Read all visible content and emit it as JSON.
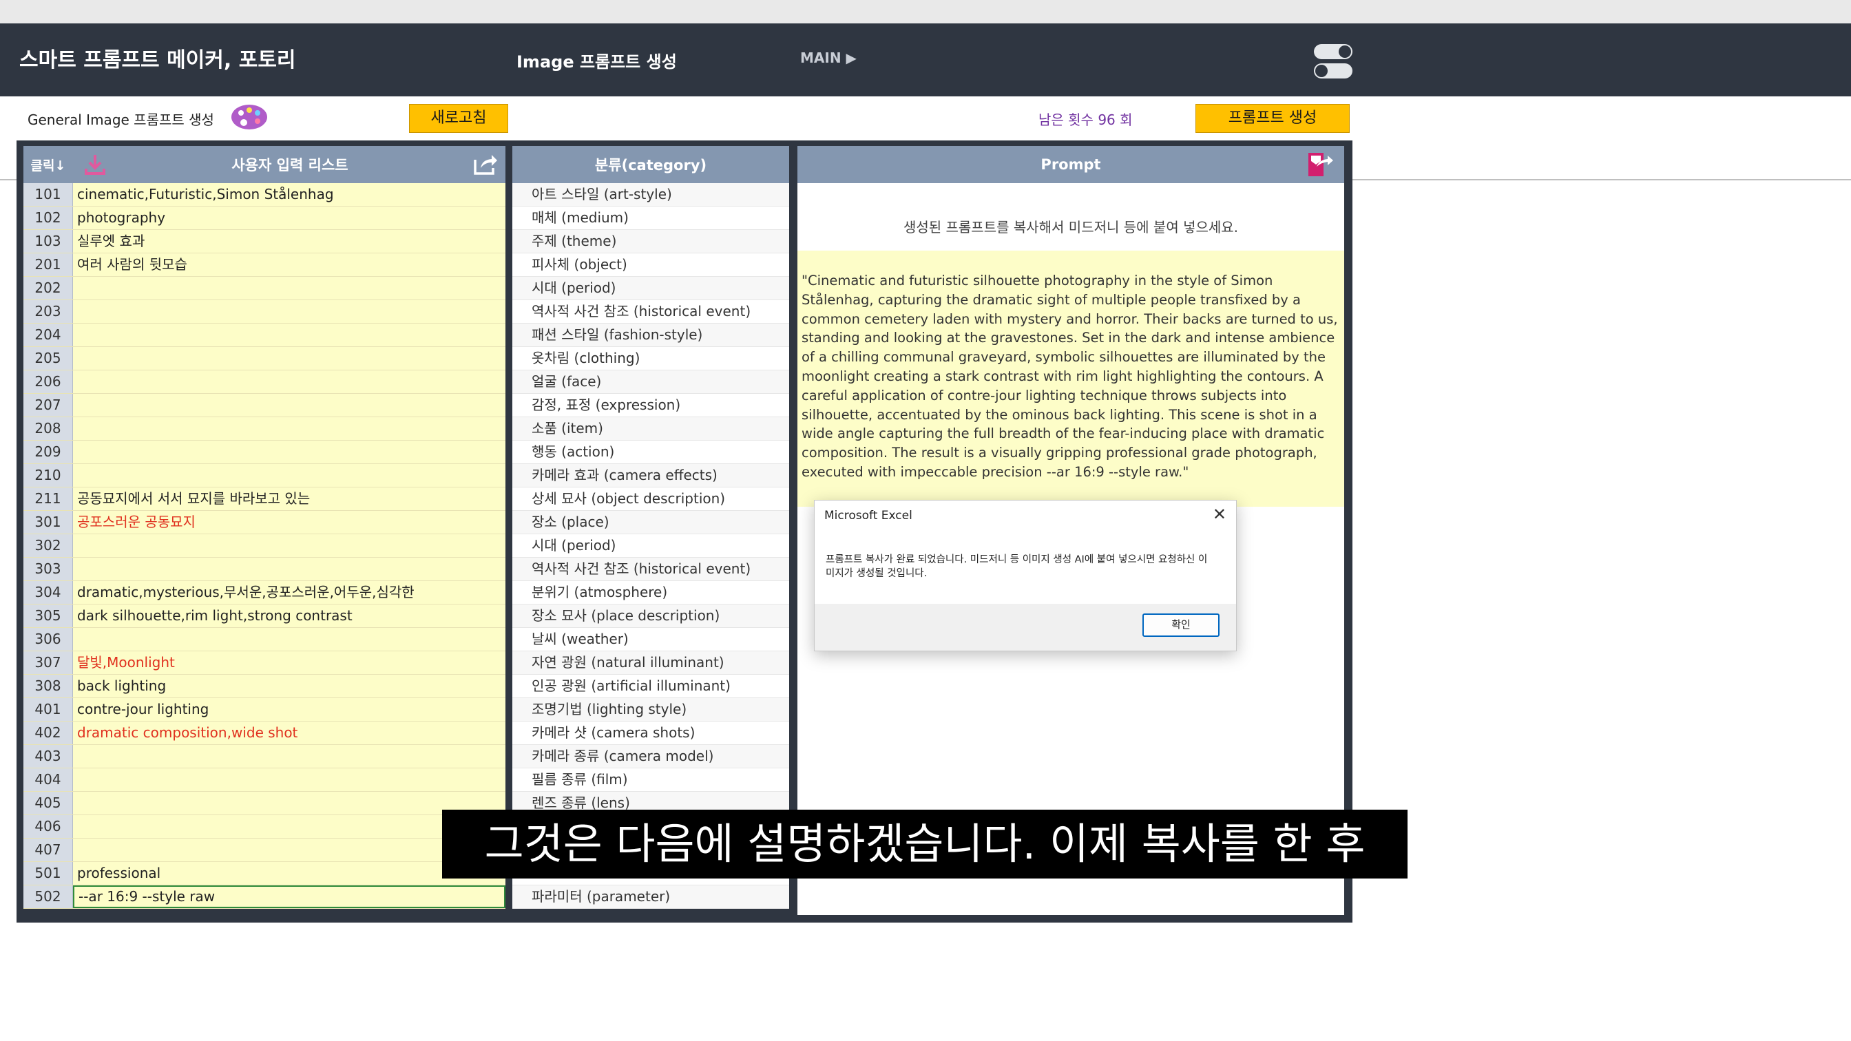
{
  "header": {
    "app_title": "스마트 프롬프트 메이커, 포토리",
    "page_title": "Image 프롬프트 생성",
    "main_link": "MAIN ▶"
  },
  "toolbar": {
    "subtitle": "General Image 프롬프트 생성",
    "refresh_label": "새로고침",
    "remaining": "남은 횟수 96 회",
    "generate_label": "프롬프트 생성"
  },
  "input_list": {
    "click_header": "클릭↓",
    "title": "사용자 입력 리스트",
    "rows": [
      {
        "num": "101",
        "value": "cinematic,Futuristic,Simon Stålenhag",
        "red": false
      },
      {
        "num": "102",
        "value": "photography",
        "red": false
      },
      {
        "num": "103",
        "value": "실루엣 효과",
        "red": false
      },
      {
        "num": "201",
        "value": "여러 사람의 뒷모습",
        "red": false
      },
      {
        "num": "202",
        "value": "",
        "red": false
      },
      {
        "num": "203",
        "value": "",
        "red": false
      },
      {
        "num": "204",
        "value": "",
        "red": false
      },
      {
        "num": "205",
        "value": "",
        "red": false
      },
      {
        "num": "206",
        "value": "",
        "red": false
      },
      {
        "num": "207",
        "value": "",
        "red": false
      },
      {
        "num": "208",
        "value": "",
        "red": false
      },
      {
        "num": "209",
        "value": "",
        "red": false
      },
      {
        "num": "210",
        "value": "",
        "red": false
      },
      {
        "num": "211",
        "value": "공동묘지에서 서서 묘지를 바라보고 있는",
        "red": false
      },
      {
        "num": "301",
        "value": "공포스러운 공동묘지",
        "red": true
      },
      {
        "num": "302",
        "value": "",
        "red": false
      },
      {
        "num": "303",
        "value": "",
        "red": false
      },
      {
        "num": "304",
        "value": "dramatic,mysterious,무서운,공포스러운,어두운,심각한",
        "red": false
      },
      {
        "num": "305",
        "value": "dark silhouette,rim light,strong contrast",
        "red": false
      },
      {
        "num": "306",
        "value": "",
        "red": false
      },
      {
        "num": "307",
        "value": "달빛,Moonlight",
        "red": true
      },
      {
        "num": "308",
        "value": "back lighting",
        "red": false
      },
      {
        "num": "401",
        "value": "contre-jour lighting",
        "red": false
      },
      {
        "num": "402",
        "value": "dramatic composition,wide shot",
        "red": true
      },
      {
        "num": "403",
        "value": "",
        "red": false
      },
      {
        "num": "404",
        "value": "",
        "red": false
      },
      {
        "num": "405",
        "value": "",
        "red": false
      },
      {
        "num": "406",
        "value": "",
        "red": false
      },
      {
        "num": "407",
        "value": "",
        "red": false
      },
      {
        "num": "501",
        "value": "professional",
        "red": false
      },
      {
        "num": "502",
        "value": "--ar 16:9 --style raw",
        "red": false
      }
    ]
  },
  "category": {
    "title": "분류(category)",
    "items": [
      "아트 스타일 (art-style)",
      "매체 (medium)",
      "주제 (theme)",
      "피사체 (object)",
      "시대 (period)",
      "역사적 사건 참조 (historical event)",
      "패션 스타일 (fashion-style)",
      "옷차림 (clothing)",
      "얼굴 (face)",
      "감정, 표정 (expression)",
      "소품 (item)",
      "행동 (action)",
      "카메라 효과 (camera effects)",
      "상세 묘사 (object description)",
      "장소 (place)",
      "시대 (period)",
      "역사적 사건 참조 (historical event)",
      "분위기 (atmosphere)",
      "장소 묘사 (place description)",
      "날씨 (weather)",
      "자연 광원 (natural illuminant)",
      "인공 광원 (artificial illuminant)",
      "조명기법 (lighting style)",
      "카메라 샷 (camera shots)",
      "카메라 종류 (camera model)",
      "필름 종류 (film)",
      "렌즈 종류 (lens)",
      "",
      "",
      "",
      "파라미터 (parameter)"
    ]
  },
  "prompt": {
    "title": "Prompt",
    "instruction": "생성된 프롬프트를 복사해서 미드저니 등에 붙여 넣으세요.",
    "text": "\"Cinematic and futuristic silhouette photography in the style of Simon Stålenhag, capturing the dramatic sight of multiple people transfixed by a common cemetery laden with mystery and horror. Their backs are turned to us, standing and looking at the gravestones. Set in the dark and intense ambience of a chilling communal graveyard, symbolic silhouettes are illuminated by the moonlight creating a stark contrast with rim light highlighting the contours. A careful application of contre-jour lighting technique throws subjects into silhouette, accentuated by the ominous back lighting. This scene is shot in a wide angle capturing the full breadth of the fear-inducing place with dramatic composition. The result is a visually gripping professional grade photograph, executed with impeccable precision --ar 16:9 --style raw.\""
  },
  "dialog": {
    "title": "Microsoft Excel",
    "message": "프롬프트 복사가 완료 되었습니다. 미드저니 등 이미지 생성 AI에 붙여 넣으시면 요청하신 이미지가 생성될 것입니다.",
    "ok_label": "확인"
  },
  "caption": {
    "text": "그것은 다음에 설명하겠습니다. 이제 복사를 한 후"
  },
  "colors": {
    "header_bg": "#2f3641",
    "column_header": "#8497b0",
    "cell_yellow": "#fdfdc8",
    "button_yellow": "#ffc000",
    "remaining_text": "#7030a0",
    "red_text": "#e0301e"
  }
}
